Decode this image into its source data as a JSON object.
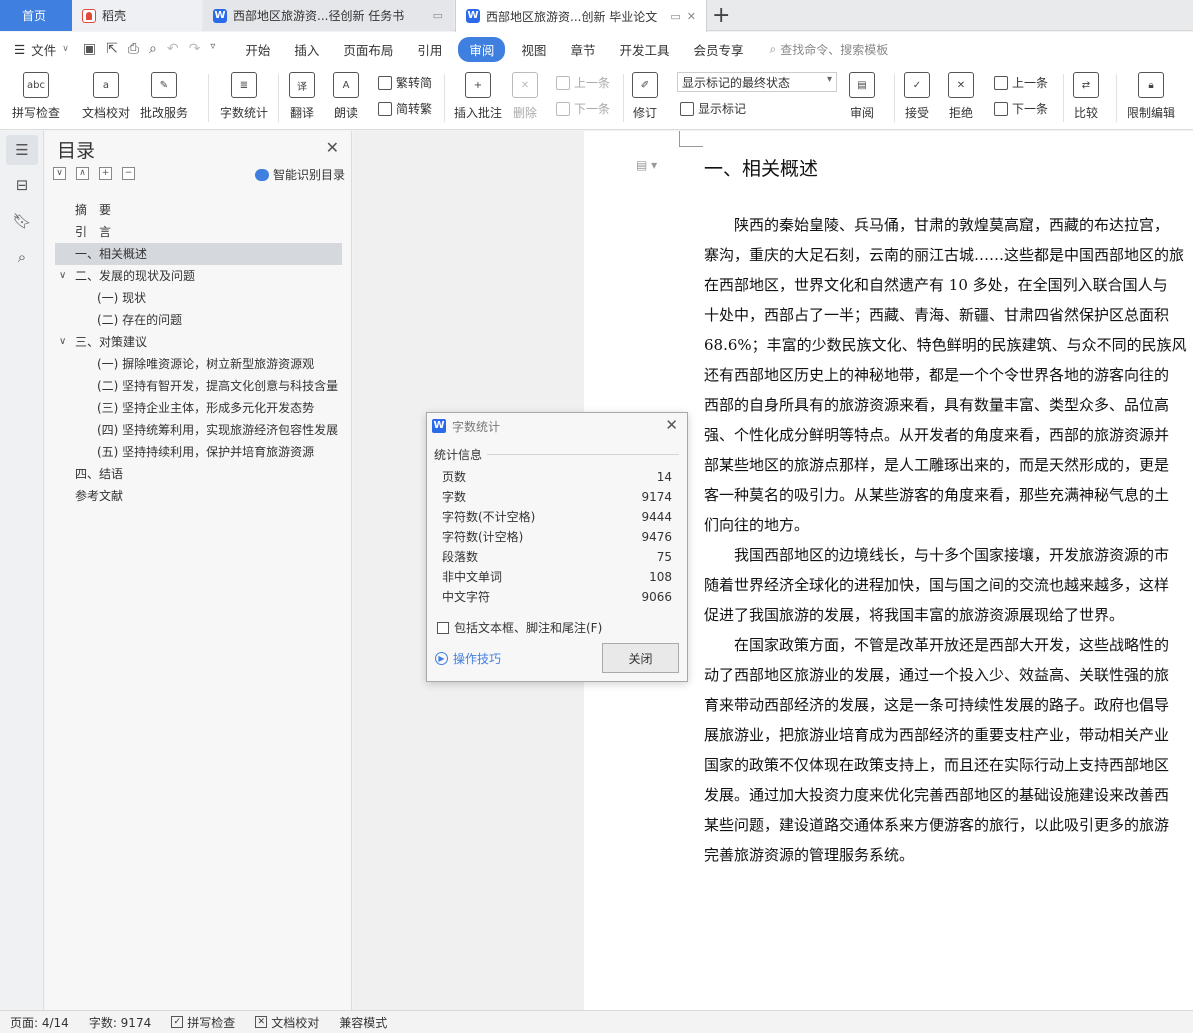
{
  "tabs": {
    "home": "首页",
    "daoke": "稻壳",
    "doc1": "西部地区旅游资...径创新 任务书",
    "doc2": "西部地区旅游资...创新 毕业论文",
    "new_tab": "+"
  },
  "menu": {
    "file": "文件",
    "items": [
      "开始",
      "插入",
      "页面布局",
      "引用",
      "审阅",
      "视图",
      "章节",
      "开发工具",
      "会员专享"
    ],
    "active": "审阅",
    "search": "查找命令、搜索模板"
  },
  "ribbon": {
    "spell_check": "拼写检查",
    "doc_proof": "文档校对",
    "revise_service": "批改服务",
    "word_count": "字数统计",
    "translate": "翻译",
    "read_aloud": "朗读",
    "trad_to_simp": "繁转简",
    "simp_to_trad": "简转繁",
    "insert_comment": "插入批注",
    "delete": "删除",
    "prev_comment": "上一条",
    "next_comment": "下一条",
    "revise": "修订",
    "markup_mode": "显示标记的最终状态",
    "show_markup": "显示标记",
    "review": "审阅",
    "accept": "接受",
    "reject": "拒绝",
    "prev_change": "上一条",
    "next_change": "下一条",
    "compare": "比较",
    "restrict_edit": "限制编辑"
  },
  "toc": {
    "title": "目录",
    "smart": "智能识别目录",
    "items": [
      "摘　要",
      "引　言",
      "一、相关概述",
      "二、发展的现状及问题",
      "(一) 现状",
      "(二) 存在的问题",
      "三、对策建议",
      "(一) 摒除唯资源论，树立新型旅游资源观",
      "(二) 坚持有智开发，提高文化创意与科技含量",
      "(三) 坚持企业主体，形成多元化开发态势",
      "(四) 坚持统筹利用，实现旅游经济包容性发展",
      "(五) 坚持持续利用，保护并培育旅游资源",
      "四、结语",
      "参考文献"
    ]
  },
  "document": {
    "heading": "一、相关概述",
    "lines": [
      "　　陕西的秦始皇陵、兵马俑，甘肃的敦煌莫高窟，西藏的布达拉宫，",
      "寨沟，重庆的大足石刻，云南的丽江古城……这些都是中国西部地区的旅",
      "在西部地区，世界文化和自然遗产有 10 多处，在全国列入联合国人与",
      "十处中，西部占了一半；西藏、青海、新疆、甘肃四省然保护区总面积",
      "68.6%；丰富的少数民族文化、特色鲜明的民族建筑、与众不同的民族风",
      "还有西部地区历史上的神秘地带，都是一个个令世界各地的游客向往的",
      "西部的自身所具有的旅游资源来看，具有数量丰富、类型众多、品位高",
      "强、个性化成分鲜明等特点。从开发者的角度来看，西部的旅游资源并",
      "部某些地区的旅游点那样，是人工雕琢出来的，而是天然形成的，更是",
      "客一种莫名的吸引力。从某些游客的角度来看，那些充满神秘气息的土",
      "们向往的地方。",
      "　　我国西部地区的边境线长，与十多个国家接壤，开发旅游资源的市",
      "随着世界经济全球化的进程加快，国与国之间的交流也越来越多，这样",
      "促进了我国旅游的发展，将我国丰富的旅游资源展现给了世界。",
      "　　在国家政策方面，不管是改革开放还是西部大开发，这些战略性的",
      "动了西部地区旅游业的发展，通过一个投入少、效益高、关联性强的旅",
      "育来带动西部经济的发展，这是一条可持续性发展的路子。政府也倡导",
      "展旅游业，把旅游业培育成为西部经济的重要支柱产业，带动相关产业",
      "国家的政策不仅体现在政策支持上，而且还在实际行动上支持西部地区",
      "发展。通过加大投资力度来优化完善西部地区的基础设施建设来改善西",
      "某些问题，建设道路交通体系来方便游客的旅行，以此吸引更多的旅游",
      "完善旅游资源的管理服务系统。"
    ]
  },
  "dialog": {
    "title": "字数统计",
    "section": "统计信息",
    "stats": [
      {
        "label": "页数",
        "value": "14"
      },
      {
        "label": "字数",
        "value": "9174"
      },
      {
        "label": "字符数(不计空格)",
        "value": "9444"
      },
      {
        "label": "字符数(计空格)",
        "value": "9476"
      },
      {
        "label": "段落数",
        "value": "75"
      },
      {
        "label": "非中文单词",
        "value": "108"
      },
      {
        "label": "中文字符",
        "value": "9066"
      }
    ],
    "include_label": "包括文本框、脚注和尾注(F)",
    "include_checked": false,
    "tips": "操作技巧",
    "close": "关闭"
  },
  "status": {
    "page": "页面: 4/14",
    "words": "字数: 9174",
    "spell_check": "拼写检查",
    "doc_proof": "文档校对",
    "compat": "兼容模式"
  },
  "colors": {
    "accent": "#3f7fe0"
  }
}
